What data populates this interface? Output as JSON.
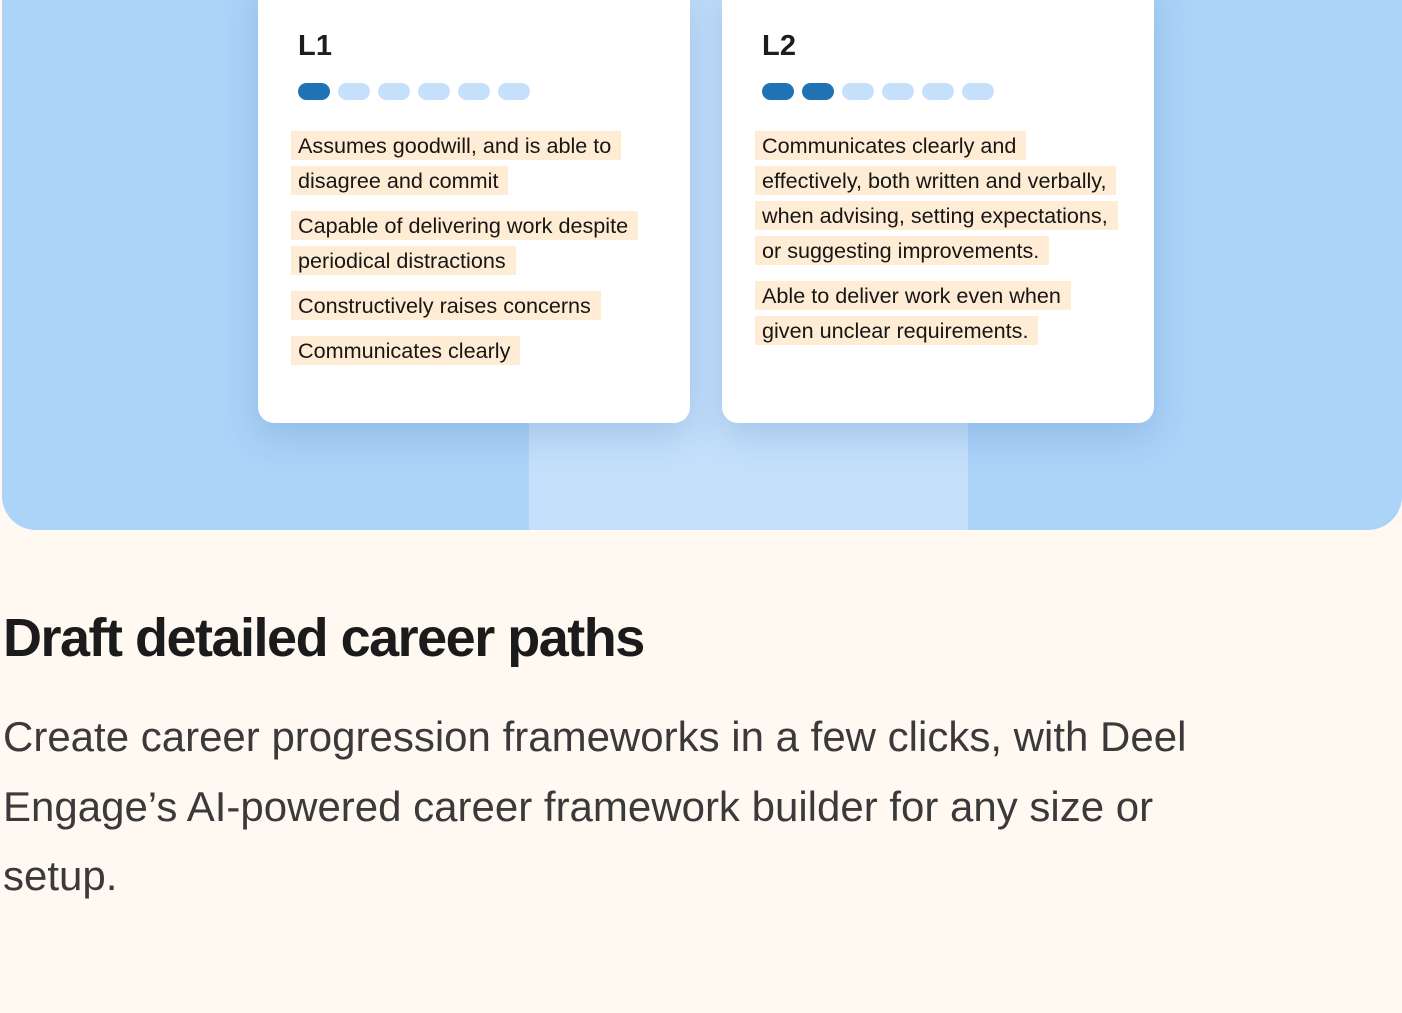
{
  "cards": [
    {
      "title": "L1",
      "level_filled": 1,
      "level_total": 6,
      "behaviors": [
        "Assumes goodwill, and is able to disagree and commit",
        "Capable of delivering work despite periodical distractions",
        "Constructively raises concerns",
        "Communicates clearly"
      ]
    },
    {
      "title": "L2",
      "level_filled": 2,
      "level_total": 6,
      "behaviors": [
        "Communicates clearly and effectively, both written and verbally, when advising, setting expectations, or suggesting improvements.",
        "Able to deliver work even when given unclear requirements."
      ]
    }
  ],
  "section": {
    "headline": "Draft detailed career paths",
    "description": "Create career progression frameworks in a few clicks, with Deel Engage’s AI-powered career framework builder for any size or setup."
  },
  "colors": {
    "hero_background": "#acd3f8",
    "hero_column": "#c4e0fb",
    "dot_active": "#1f73b5",
    "dot_inactive": "#c6e0fb",
    "highlight": "#ffecd4",
    "page_background": "#fff9f2"
  }
}
